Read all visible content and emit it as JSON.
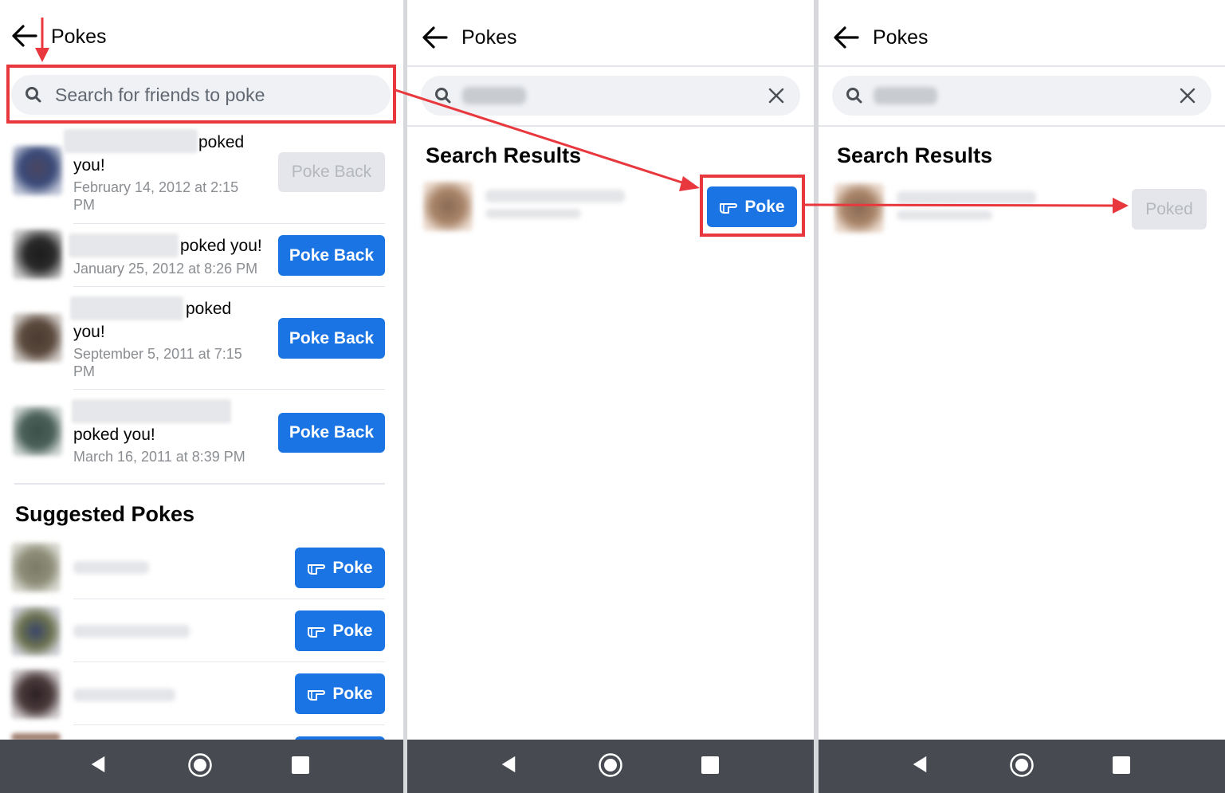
{
  "panels": [
    {
      "title": "Pokes",
      "search_placeholder": "Search for friends to poke",
      "pokes": [
        {
          "text_a": "poked",
          "text_b": "you!",
          "date_a": "February 14, 2012 at 2:15",
          "date_b": "PM",
          "button": "Poke Back",
          "enabled": false
        },
        {
          "text_a": "poked you!",
          "date_a": "January 25, 2012 at 8:26 PM",
          "button": "Poke Back",
          "enabled": true
        },
        {
          "text_a": "poked",
          "text_b": "you!",
          "date_a": "September 5, 2011 at 7:15",
          "date_b": "PM",
          "button": "Poke Back",
          "enabled": true
        },
        {
          "text_a": "poked you!",
          "date_a": "March 16, 2011 at 8:39 PM",
          "button": "Poke Back",
          "enabled": true
        }
      ],
      "suggested_title": "Suggested Pokes",
      "suggested": [
        {
          "button": "Poke"
        },
        {
          "button": "Poke"
        },
        {
          "button": "Poke"
        }
      ]
    },
    {
      "title": "Pokes",
      "results_title": "Search Results",
      "result_button": "Poke"
    },
    {
      "title": "Pokes",
      "results_title": "Search Results",
      "result_button": "Poked"
    }
  ],
  "colors": {
    "accent": "#1b74e4",
    "annotation": "#e8383d",
    "navbar": "#474b51"
  }
}
